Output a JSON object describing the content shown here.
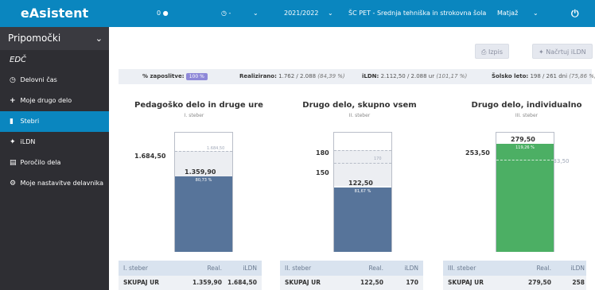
{
  "header": {
    "brand": "eAsistent",
    "notifications": "0",
    "clock": "-",
    "year": "2021/2022",
    "school": "ŠC PET - Srednja tehniška in strokovna šola",
    "user": "Matjaž"
  },
  "sidebar": {
    "title": "Pripomočki",
    "section": "EDČ",
    "items": [
      {
        "icon": "clock-icon",
        "label": "Delovni čas"
      },
      {
        "icon": "plus-icon",
        "label": "Moje drugo delo"
      },
      {
        "icon": "bar-chart-icon",
        "label": "Stebri",
        "active": true
      },
      {
        "icon": "magic-wand-icon",
        "label": "iLDN"
      },
      {
        "icon": "report-icon",
        "label": "Poročilo dela"
      },
      {
        "icon": "gear-icon",
        "label": "Moje nastavitve delavnika"
      }
    ]
  },
  "toolbar": {
    "print_label": "Izpis",
    "plan_label": "Načrtuj iLDN"
  },
  "stats": {
    "employment_label": "% zaposlitve:",
    "employment_value": "100 %",
    "realized_label": "Realizirano:",
    "realized_value": "1.762 / 2.088",
    "realized_pct": "(84,39 %)",
    "ildn_label": "iLDN:",
    "ildn_value": "2.112,50 / 2.088 ur",
    "ildn_pct": "(101,17 %)",
    "school_year_label": "Šolsko leto:",
    "school_year_value": "198 / 261 dni",
    "school_year_pct": "(75,86 %)"
  },
  "columns": [
    {
      "title": "Pedagoško delo in druge ure",
      "subtitle": "I. steber",
      "plan_outside": "1.684,50",
      "plan_inside": "1.684,50",
      "real_value": "1.359,90",
      "real_pct": "80,73 %",
      "real_frac": 0.8073,
      "color": "#57749a",
      "table": {
        "h1": "I. steber",
        "h2": "Real.",
        "h3": "iLDN",
        "r1": "SKUPAJ UR",
        "r2": "1.359,90",
        "r3": "1.684,50"
      }
    },
    {
      "title": "Drugo delo, skupno vsem",
      "subtitle": "II. steber",
      "plan_outside": "180",
      "plan_inside": "170",
      "secondary_outside": "150",
      "real_value": "122,50",
      "real_pct": "81,67 %",
      "color": "#57749a",
      "table": {
        "h1": "II. steber",
        "h2": "Real.",
        "h3": "iLDN",
        "r1": "SKUPAJ UR",
        "r2": "122,50",
        "r3": "170"
      }
    },
    {
      "title": "Drugo delo, individualno",
      "subtitle": "III. steber",
      "plan_outside": "253,50",
      "plan_inside": "233,50",
      "real_value": "279,50",
      "real_pct": "119,26 %",
      "color": "#4caf64",
      "table": {
        "h1": "III. steber",
        "h2": "Real.",
        "h3": "iLDN",
        "r1": "SKUPAJ UR",
        "r2": "279,50",
        "r3": "258"
      }
    }
  ]
}
